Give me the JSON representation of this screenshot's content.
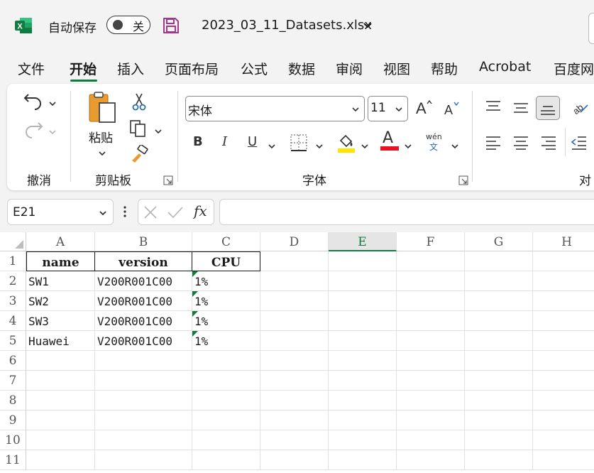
{
  "titlebar": {
    "autosave_label": "自动保存",
    "autosave_state": "关",
    "file_name": "2023_03_11_Datasets.xlsx",
    "accent": "#107c41",
    "save_icon_color": "#a4378a"
  },
  "tabs": [
    "文件",
    "开始",
    "插入",
    "页面布局",
    "公式",
    "数据",
    "审阅",
    "视图",
    "帮助",
    "Acrobat",
    "百度网"
  ],
  "active_tab": "开始",
  "ribbon": {
    "undo_group_label": "撤消",
    "clipboard_group_label": "剪贴板",
    "paste_label": "粘贴",
    "font_group_label": "字体",
    "font_name": "宋体",
    "font_size": "11",
    "bold_label": "B",
    "italic_label": "I",
    "underline_label": "U",
    "font_color_label": "A",
    "font_color": "#e81123",
    "fill_color": "#ffe600",
    "phonetic_top": "wén",
    "phonetic_bottom": "文",
    "align_group_label_partial": "对"
  },
  "formula_bar": {
    "name_box": "E21",
    "formula_value": "",
    "fx_label": "fx"
  },
  "sheet": {
    "selected_column": "E",
    "columns": [
      "A",
      "B",
      "C",
      "D",
      "E",
      "F",
      "G",
      "H"
    ],
    "rows": [
      "1",
      "2",
      "3",
      "4",
      "5",
      "6",
      "7",
      "8",
      "9",
      "10",
      "11"
    ],
    "header": [
      "name",
      "version",
      "CPU"
    ],
    "data": [
      [
        "SW1",
        "V200R001C00",
        "1%"
      ],
      [
        "SW2",
        "V200R001C00",
        "1%"
      ],
      [
        "SW3",
        "V200R001C00",
        "1%"
      ],
      [
        "Huawei",
        "V200R001C00",
        "1%"
      ]
    ]
  }
}
